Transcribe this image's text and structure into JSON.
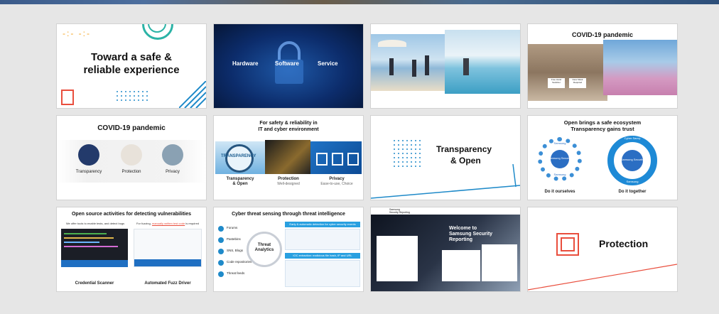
{
  "slides": [
    {
      "title_line1": "Toward a safe &",
      "title_line2": "reliable experience"
    },
    {
      "labels": [
        "Hardware",
        "Software",
        "Service"
      ]
    },
    {},
    {
      "title": "COVID-19 pandemic",
      "signs": [
        "Free Hand Sanitizer",
        "Face Mask Required"
      ]
    },
    {
      "title": "COVID-19 pandemic",
      "labels": [
        "Transparency",
        "Protection",
        "Privacy"
      ]
    },
    {
      "title_line1": "For safety & reliability in",
      "title_line2": "IT and cyber environment",
      "magnifier_text": "TRANSPARENCY",
      "cols": [
        {
          "label": "Transparency",
          "label2": "& Open",
          "sub": ""
        },
        {
          "label": "Protection",
          "label2": "",
          "sub": "Well-designed"
        },
        {
          "label": "Privacy",
          "label2": "",
          "sub": "Ease-to-use, Choice"
        }
      ]
    },
    {
      "title_line1": "Transparency",
      "title_line2": "& Open"
    },
    {
      "title_line1": "Open brings a safe ecosystem",
      "title_line2": "Transparency gains trust",
      "left_center": "Samsung Security",
      "right_center": "Samsung Security",
      "left_top": "Samsung",
      "right_top": "Cyber Savvy",
      "left_bottom": "Samsung",
      "right_bottom": "Samsung",
      "left_caption": "Do it ourselves",
      "right_caption": "Do it together"
    },
    {
      "title": "Open source activities for detecting vulnerabilities",
      "left_heading": "We offer tools to enable tests, and detect bugs",
      "right_heading_pre": "For fuzzing, ",
      "right_heading_underline": "manually written test code",
      "right_heading_post": " is required",
      "left_caption": "Credential Scanner",
      "right_caption": "Automated Fuzz Driver"
    },
    {
      "title": "Cyber threat sensing through threat intelligence",
      "items": [
        "Forums",
        "Pastebins",
        "SNS, Blogs",
        "Code repositories",
        "Threat feeds"
      ],
      "center_line1": "Threat",
      "center_line2": "Analytics",
      "banner_top": "Early & automatic detection for cyber security events",
      "banner_bottom": "IOC extraction: malicious file hash, IP and URL"
    },
    {
      "brand_line1": "Samsung",
      "brand_line2": "Security Reporting",
      "welcome_line1": "Welcome to",
      "welcome_line2": "Samsung Security",
      "welcome_line3": "Reporting"
    },
    {
      "title": "Protection"
    }
  ]
}
